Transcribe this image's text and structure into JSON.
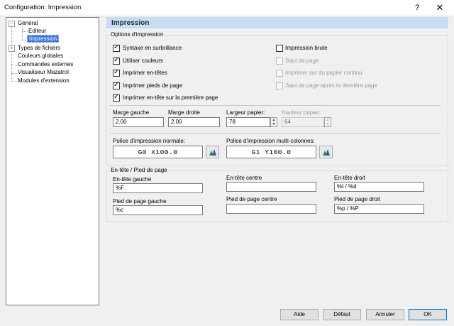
{
  "window": {
    "title": "Configuration: Impression",
    "help_glyph": "?",
    "close_glyph": "✕"
  },
  "tree": {
    "general": "Général",
    "editor": "Éditeur",
    "printing": "Impression",
    "file_types": "Types de fichiers",
    "global_colors": "Couleurs globales",
    "external_commands": "Commandes externes",
    "mazatrol_viewer": "Visualiseur Mazatrol",
    "extension_modules": "Modules d'extension",
    "expand_minus": "−",
    "expand_plus": "+"
  },
  "panel": {
    "title": "Impression",
    "print_options": {
      "label": "Options d'impression",
      "syntax_highlight": {
        "label": "Syntaxe en surbrillance",
        "checked": true,
        "enabled": true
      },
      "use_colors": {
        "label": "Utiliser couleurs",
        "checked": true,
        "enabled": true
      },
      "print_headers": {
        "label": "Imprimer en-têtes",
        "checked": true,
        "enabled": true
      },
      "print_footers": {
        "label": "Imprimer pieds de page",
        "checked": true,
        "enabled": true
      },
      "header_first_page": {
        "label": "Imprimer en-tête sur la première page",
        "checked": true,
        "enabled": true
      },
      "raw_print": {
        "label": "Impression brute",
        "checked": false,
        "enabled": true
      },
      "page_break": {
        "label": "Saut de page",
        "checked": false,
        "enabled": false
      },
      "continuous_paper": {
        "label": "Imprimer sur du papier continu",
        "checked": false,
        "enabled": false
      },
      "page_break_after_last": {
        "label": "Saut de page après la dernière page",
        "checked": false,
        "enabled": false
      }
    },
    "margins": {
      "left_label": "Marge gauche",
      "left_value": "2.00",
      "right_label": "Marge droite",
      "right_value": "2.00",
      "paper_width_label": "Largeur papier:",
      "paper_width_value": "78",
      "paper_height_label": "Hauteur papier:",
      "paper_height_value": "64"
    },
    "fonts": {
      "normal_label": "Police d'impression normale:",
      "normal_value": "G0 X100.0",
      "multi_label": "Police d'impression multi-colonnes:",
      "multi_value": "G1 Y100.0"
    },
    "header_footer": {
      "label": "En-tête / Pied de page",
      "header_left_label": "En-tête gauche",
      "header_left_value": "%F",
      "header_center_label": "En-tête centre",
      "header_center_value": "",
      "header_right_label": "En-tête droit",
      "header_right_value": "%t / %d",
      "footer_left_label": "Pied de page gauche",
      "footer_left_value": "%c",
      "footer_center_label": "Pied de page centre",
      "footer_center_value": "",
      "footer_right_label": "Pied de page droit",
      "footer_right_value": "%p / %P"
    }
  },
  "buttons": {
    "help": "Aide",
    "default": "Défaut",
    "cancel": "Annuler",
    "ok": "OK"
  },
  "colors": {
    "header_bar": "#c8ddf2",
    "selection": "#3a78d7",
    "default_button_border": "#0078d7"
  },
  "icons": {
    "font_picker": "font-picker-icon"
  }
}
